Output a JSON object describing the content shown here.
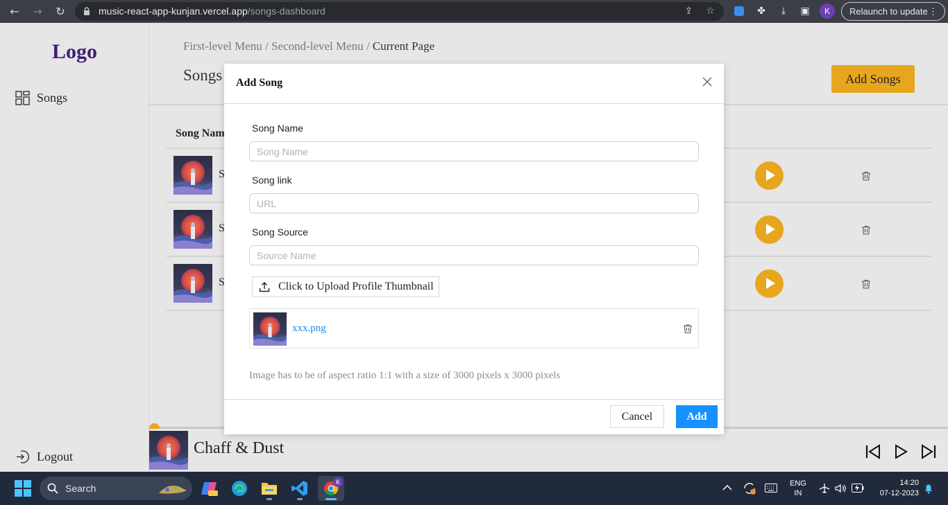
{
  "browser": {
    "url_host": "music-react-app-kunjan.vercel.app",
    "url_path": "/songs-dashboard",
    "profile_initial": "K",
    "relaunch_label": "Relaunch to update",
    "relaunch_menu": "⋮"
  },
  "sidebar": {
    "logo": "Logo",
    "songs_label": "Songs",
    "logout_label": "Logout"
  },
  "main": {
    "breadcrumb": {
      "first": "First-level Menu",
      "sep1": " / ",
      "second": "Second-level Menu",
      "sep2": " / ",
      "current": "Current Page"
    },
    "title": "Songs",
    "add_songs_label": "Add Songs",
    "table_header_name": "Song Name",
    "rows": [
      {
        "name_visible": "So"
      },
      {
        "name_visible": "S"
      },
      {
        "name_visible": "S"
      }
    ]
  },
  "modal": {
    "title": "Add Song",
    "song_name_label": "Song Name",
    "song_name_placeholder": "Song Name",
    "song_link_label": "Song link",
    "song_link_placeholder": "URL",
    "song_source_label": "Song Source",
    "song_source_placeholder": "Source Name",
    "upload_label": "Click to Upload Profile Thumbnail",
    "file_name": "xxx.png",
    "hint": "Image has to be of aspect ratio 1:1 with a size of 3000 pixels x 3000 pixels",
    "cancel_label": "Cancel",
    "add_label": "Add"
  },
  "player": {
    "title": "Chaff & Dust",
    "progress": 0.0
  },
  "taskbar": {
    "search_label": "Search",
    "lang_line1": "ENG",
    "lang_line2": "IN",
    "time": "14:20",
    "date": "07-12-2023",
    "chrome_badge": "K"
  },
  "colors": {
    "accent_gold": "#e7a61d",
    "primary_blue": "#1890ff",
    "logo_purple": "#3f1f73"
  }
}
